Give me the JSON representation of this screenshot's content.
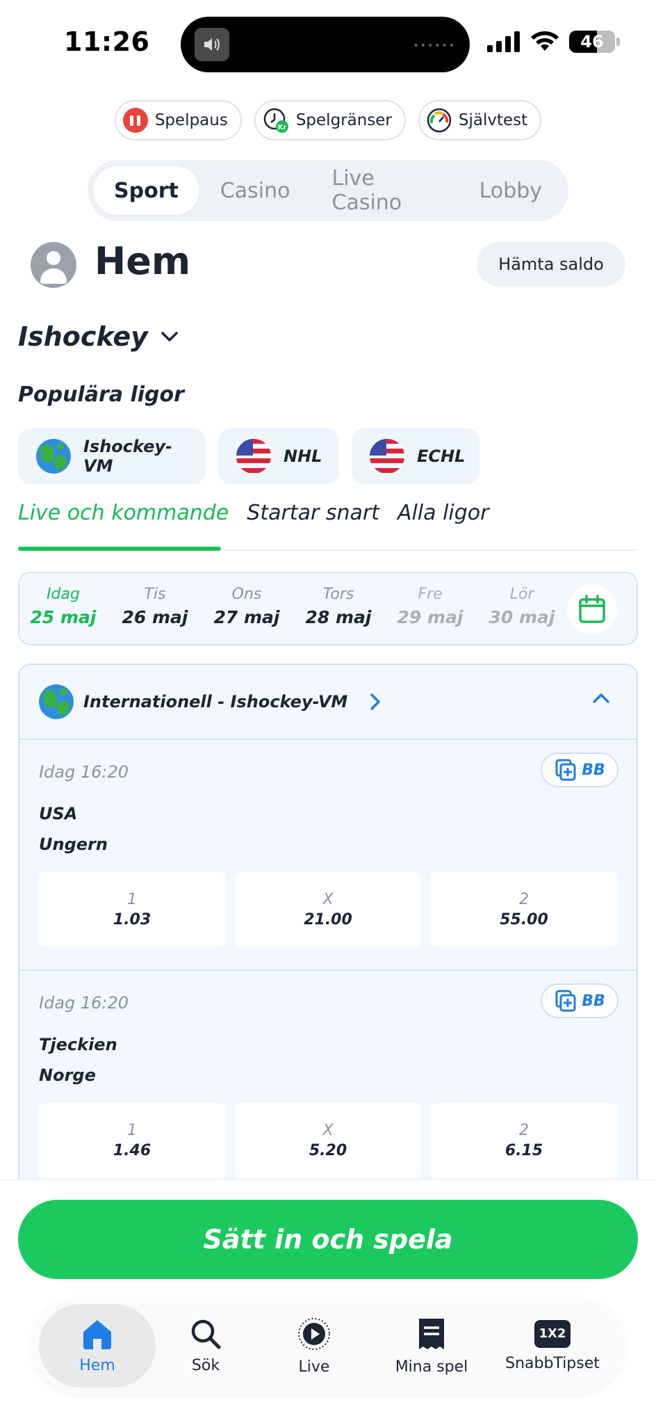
{
  "status_bar": {
    "time": "11:26",
    "battery": "46"
  },
  "responsible_gaming": [
    {
      "label": "Spelpaus"
    },
    {
      "label": "Spelgränser"
    },
    {
      "label": "Självtest"
    }
  ],
  "product_tabs": [
    {
      "label": "Sport",
      "active": true
    },
    {
      "label": "Casino",
      "active": false
    },
    {
      "label": "Live Casino",
      "active": false
    },
    {
      "label": "Lobby",
      "active": false
    }
  ],
  "header": {
    "title": "Hem",
    "balance_button": "Hämta saldo"
  },
  "sport_selector": {
    "selected": "Ishockey"
  },
  "popular_leagues": {
    "title": "Populära ligor",
    "items": [
      {
        "label": "Ishockey-VM",
        "icon": "globe-icon"
      },
      {
        "label": "NHL",
        "icon": "us-flag-icon"
      },
      {
        "label": "ECHL",
        "icon": "us-flag-icon"
      }
    ]
  },
  "sub_tabs": [
    {
      "label": "Live och kommande",
      "active": true
    },
    {
      "label": "Startar snart",
      "active": false
    },
    {
      "label": "Alla ligor",
      "active": false
    }
  ],
  "dates": [
    {
      "day": "Idag",
      "date": "25 maj",
      "state": "today"
    },
    {
      "day": "Tis",
      "date": "26 maj",
      "state": "normal"
    },
    {
      "day": "Ons",
      "date": "27 maj",
      "state": "normal"
    },
    {
      "day": "Tors",
      "date": "28 maj",
      "state": "normal"
    },
    {
      "day": "Fre",
      "date": "29 maj",
      "state": "faded"
    },
    {
      "day": "Lör",
      "date": "30 maj",
      "state": "faded"
    }
  ],
  "event_group": {
    "title": "Internationell - Ishockey-VM",
    "bb_label": "BB",
    "matches": [
      {
        "time": "Idag 16:20",
        "home": "USA",
        "away": "Ungern",
        "odds": [
          {
            "selection": "1",
            "price": "1.03"
          },
          {
            "selection": "X",
            "price": "21.00"
          },
          {
            "selection": "2",
            "price": "55.00"
          }
        ]
      },
      {
        "time": "Idag 16:20",
        "home": "Tjeckien",
        "away": "Norge",
        "odds": [
          {
            "selection": "1",
            "price": "1.46"
          },
          {
            "selection": "X",
            "price": "5.20"
          },
          {
            "selection": "2",
            "price": "6.15"
          }
        ]
      }
    ]
  },
  "cta": {
    "label": "Sätt in och spela"
  },
  "bottom_nav": [
    {
      "label": "Hem",
      "icon": "home-icon",
      "active": true
    },
    {
      "label": "Sök",
      "icon": "search-icon",
      "active": false
    },
    {
      "label": "Live",
      "icon": "live-play-icon",
      "active": false
    },
    {
      "label": "Mina spel",
      "icon": "bet-slip-icon",
      "active": false
    },
    {
      "label": "SnabbTipset",
      "icon": "1x2-icon",
      "active": false,
      "badge": "1X2"
    }
  ],
  "colors": {
    "accent_green": "#1bc95f",
    "accent_blue": "#1f7ee6",
    "text": "#1d2433",
    "muted": "#8a93a3"
  }
}
